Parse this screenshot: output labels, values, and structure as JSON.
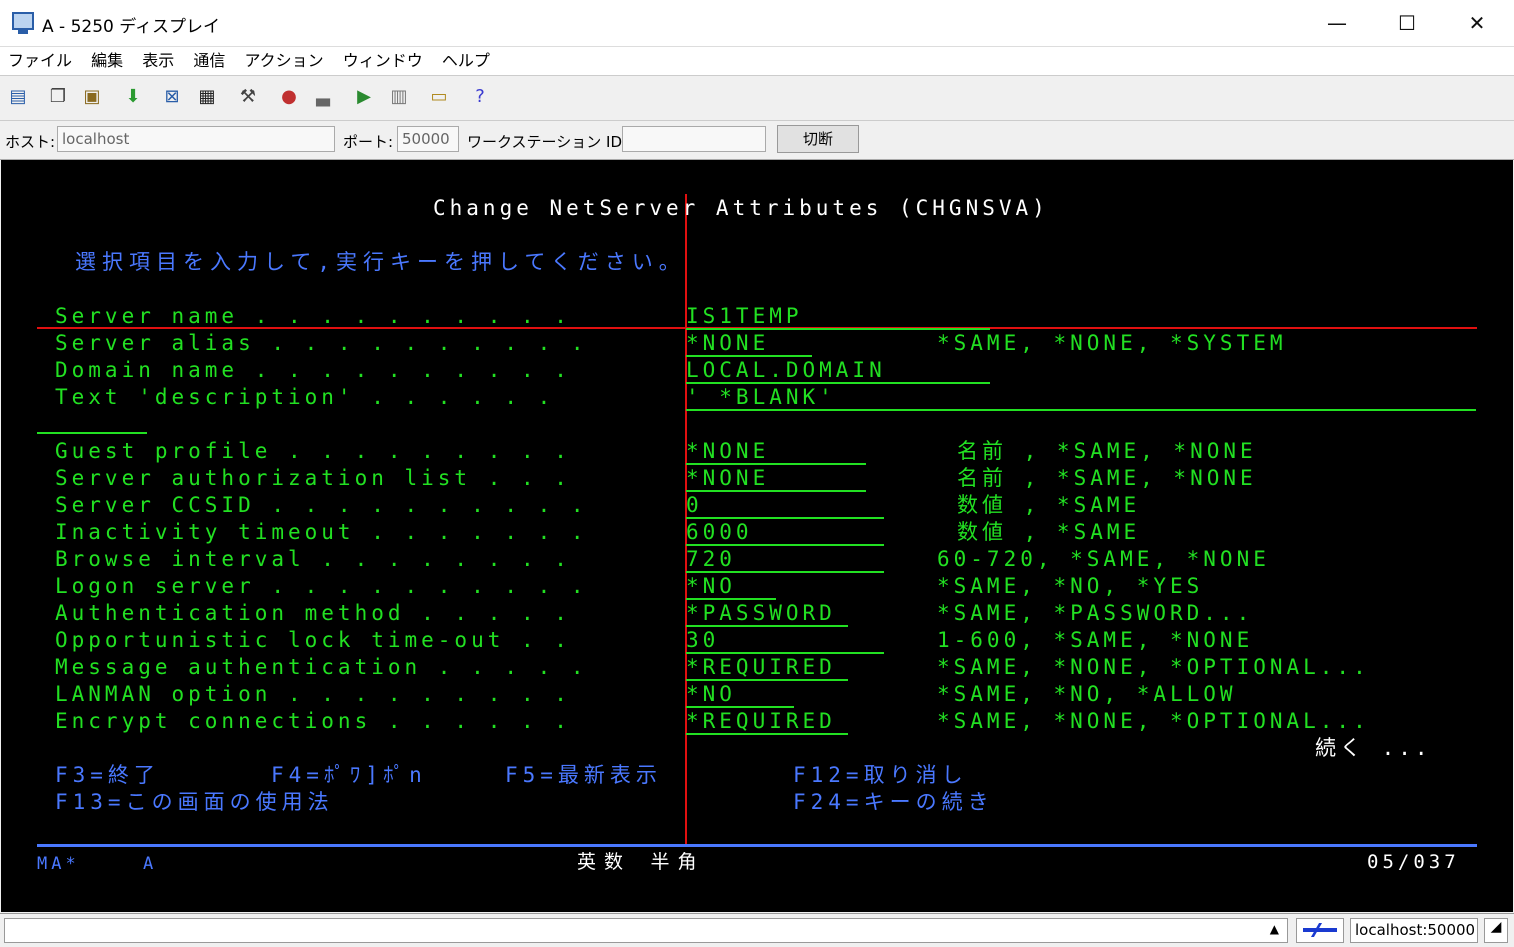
{
  "window": {
    "title": "A - 5250 ディスプレイ",
    "minimize": "—",
    "maximize": "☐",
    "close": "✕"
  },
  "menu": [
    "ファイル",
    "編集",
    "表示",
    "通信",
    "アクション",
    "ウィンドウ",
    "ヘルプ"
  ],
  "toolbar_icons": [
    "copy-screen-icon",
    "copy-icon",
    "paste-icon",
    "download-icon",
    "send-icon",
    "grid-icon",
    "macro-icon",
    "record-icon",
    "print-icon",
    "transfer-icon",
    "stop-icon",
    "notes-icon",
    "help-icon"
  ],
  "connection": {
    "host_label": "ホスト:",
    "host_value": "localhost",
    "port_label": "ポート:",
    "port_value": "50000",
    "workstation_label": "ワークステーション ID:",
    "workstation_value": "",
    "disconnect_label": "切断"
  },
  "screen": {
    "title": "Change NetServer Attributes (CHGNSVA)",
    "instruction": "選択項目を入力して,実行キーを押してください。",
    "fields": [
      {
        "label": "Server name . . . . . . . . . .",
        "value": "IS1TEMP",
        "choices": ""
      },
      {
        "label": "Server alias . . . . . . . . . .",
        "value": "*NONE",
        "choices": "*SAME, *NONE, *SYSTEM"
      },
      {
        "label": "Domain name . . . . . . . . . .",
        "value": "LOCAL.DOMAIN",
        "choices": ""
      },
      {
        "label": "Text 'description' . . . . . .",
        "value": "' *BLANK'",
        "choices": ""
      },
      {
        "label": "Guest profile . . . . . . . . .",
        "value": "*NONE",
        "choices": "名前 , *SAME, *NONE"
      },
      {
        "label": "Server authorization list . . .",
        "value": "*NONE",
        "choices": "名前 , *SAME, *NONE"
      },
      {
        "label": "Server CCSID . . . . . . . . . .",
        "value": "0",
        "choices": "数値 , *SAME"
      },
      {
        "label": "Inactivity timeout . . . . . . .",
        "value": "6000",
        "choices": "数値 , *SAME"
      },
      {
        "label": "Browse interval . . . . . . . .",
        "value": "720",
        "choices": "60-720, *SAME, *NONE"
      },
      {
        "label": "Logon server . . . . . . . . . .",
        "value": "*NO",
        "choices": "*SAME, *NO, *YES"
      },
      {
        "label": "Authentication method . . . . .",
        "value": "*PASSWORD",
        "choices": "*SAME, *PASSWORD..."
      },
      {
        "label": "Opportunistic lock time-out . .",
        "value": "30",
        "choices": "1-600, *SAME, *NONE"
      },
      {
        "label": "Message authentication . . . . .",
        "value": "*REQUIRED",
        "choices": "*SAME, *NONE, *OPTIONAL..."
      },
      {
        "label": "LANMAN option . . . . . . . . .",
        "value": "*NO",
        "choices": "*SAME, *NO, *ALLOW"
      },
      {
        "label": "Encrypt connections . . . . . .",
        "value": "*REQUIRED",
        "choices": "*SAME, *NONE, *OPTIONAL..."
      }
    ],
    "more": "続く ...",
    "fkeys": {
      "f3": "F3=終了",
      "f4": "F4=ﾎﾟﾜ]ﾎﾟn",
      "f5": "F5=最新表示",
      "f12": "F12=取り消し",
      "f13": "F13=この画面の使用法",
      "f24": "F24=キーの続き"
    },
    "status": {
      "left": "MA*",
      "mode": "A",
      "input_mode": "英数 半角",
      "cursor": "05/037"
    }
  },
  "statusbar": {
    "host": "localhost:50000"
  }
}
